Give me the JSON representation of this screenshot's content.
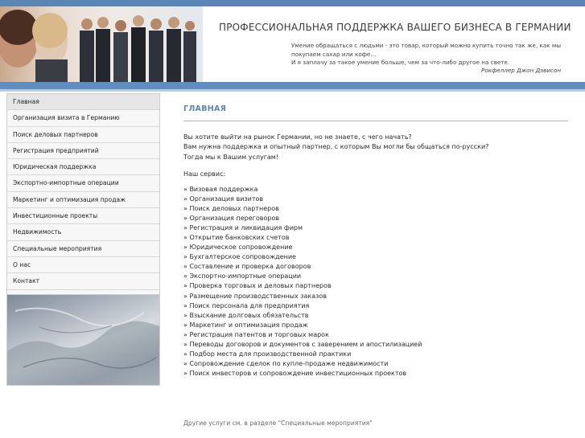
{
  "header": {
    "title": "ПРОФЕССИОНАЛЬНАЯ ПОДДЕРЖКА ВАШЕГО БИЗНЕСА В ГЕРМАНИИ",
    "quote_lines": [
      "Умение обращаться с людьми - это товар, который можно купить точно так же, как мы",
      "покупаем сахар или кофе...",
      "И я заплачу за такое умение больше, чем за что-либо другое на свете."
    ],
    "quote_author": "Рокфеллер Джон Дэвисон"
  },
  "sidebar": {
    "items": [
      {
        "label": "Главная",
        "active": true
      },
      {
        "label": "Организация визита в Германию"
      },
      {
        "label": "Поиск деловых партнеров"
      },
      {
        "label": "Регистрация предприятий"
      },
      {
        "label": "Юридическая поддержка"
      },
      {
        "label": "Экспортно-импортные операции"
      },
      {
        "label": "Маркетинг и оптимизация продаж"
      },
      {
        "label": "Инвестиционные проекты"
      },
      {
        "label": "Недвижимость"
      },
      {
        "label": "Специальные мероприятия"
      },
      {
        "label": "О нас"
      },
      {
        "label": "Контакт"
      }
    ]
  },
  "main": {
    "heading": "ГЛАВНАЯ",
    "intro_lines": [
      "Вы хотите выйти на рынок Германии, но не знаете, с чего начать?",
      "Вам нужна поддержка и опытный партнер, с которым Вы могли бы общаться по-русски?",
      "Тогда мы к Вашим услугам!"
    ],
    "services_label": "Наш сервис:",
    "services": [
      "» Визовая поддержка",
      "» Организация визитов",
      "» Поиск деловых партнеров",
      "» Организация переговоров",
      "» Регистрация и ликвидация фирм",
      "» Открытие банковских счетов",
      "» Юридическое сопровождение",
      "» Бухгалтерское сопровождение",
      "» Составление и проверка договоров",
      "» Экспортно-импортные операции",
      "» Проверка торговых и деловых партнеров",
      "» Размещение производственных заказов",
      "» Поиск персонала для предприятия",
      "» Взыскание долговых обязательств",
      "» Маркетинг и оптимизация продаж",
      "» Регистрация патентов и торговых марок",
      "» Переводы договоров и документов с заверением и апостилизацией",
      "» Подбор места для производственной практики",
      "» Сопровождение сделок по купле-продаже недвижимости",
      "» Поиск инвесторов и сопровождение инвестиционных проектов"
    ],
    "footnote": "Другие услуги см. в разделе \"Специальные мероприятия\""
  },
  "colors": {
    "accent": "#5a86b6",
    "header_bar": "#5f8dbf",
    "sidebar_bg": "#f7f7f7"
  }
}
